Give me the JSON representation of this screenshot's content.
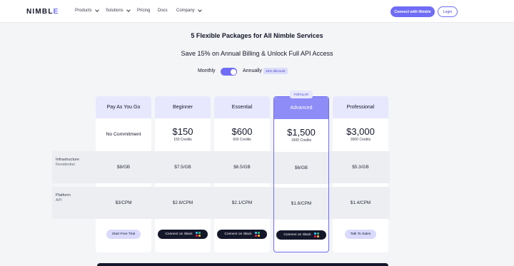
{
  "nav": {
    "logo_text": "NIMBL",
    "logo_accent": "E",
    "items": [
      {
        "label": "Products",
        "has_dropdown": true
      },
      {
        "label": "Solutions",
        "has_dropdown": true
      },
      {
        "label": "Pricing",
        "has_dropdown": false
      },
      {
        "label": "Docs",
        "has_dropdown": false
      },
      {
        "label": "Company",
        "has_dropdown": true
      }
    ],
    "connect_label": "Connect with Nimble",
    "login_label": "Login"
  },
  "headings": {
    "title": "5 Flexible Packages for All Nimble Services",
    "subtitle": "Save 15% on Annual Billing & Unlock Full API Access"
  },
  "billing": {
    "monthly_label": "Monthly",
    "annually_label": "Annually",
    "discount_badge": "15% discount",
    "annual_selected": true
  },
  "rows": [
    {
      "label": "Infrastructure",
      "sub": "Residential"
    },
    {
      "label": "Platform",
      "sub": "API"
    }
  ],
  "plans": [
    {
      "name": "Pay As You Go",
      "no_commitment": "No Commitment",
      "price": "",
      "credits": "",
      "infra": "$8/GB",
      "platform": "$3/CPM",
      "cta": "Start Free Trial",
      "cta_style": "light",
      "featured": false
    },
    {
      "name": "Beginner",
      "price": "$150",
      "credits": "150 Credits",
      "infra": "$7.5/GB",
      "platform": "$2.6/CPM",
      "cta": "Connect on Slack",
      "cta_style": "dark",
      "featured": false
    },
    {
      "name": "Essential",
      "price": "$600",
      "credits": "600 Credits",
      "infra": "$6.5/GB",
      "platform": "$2.1/CPM",
      "cta": "Connect on Slack",
      "cta_style": "dark",
      "featured": false
    },
    {
      "name": "Advanced",
      "price": "$1,500",
      "credits": "1500 Credits",
      "infra": "$6/GB",
      "platform": "$1.6/CPM",
      "cta": "Connect on Slack",
      "cta_style": "dark",
      "featured": true,
      "tag": "POPULAR"
    },
    {
      "name": "Professional",
      "price": "$3,000",
      "credits": "3000 Credits",
      "infra": "$5.3/GB",
      "platform": "$1.4/CPM",
      "cta": "Talk To Sales",
      "cta_style": "light",
      "featured": false
    }
  ],
  "icons": {
    "slack": "slack-icon",
    "chevron": "chevron-down-icon"
  },
  "colors": {
    "accent": "#6f6cf5",
    "featured_header": "#8e8cf7",
    "dark_button": "#15172a",
    "slack": [
      "#36c5f0",
      "#2eb67d",
      "#ecb22e",
      "#e01e5a"
    ]
  }
}
